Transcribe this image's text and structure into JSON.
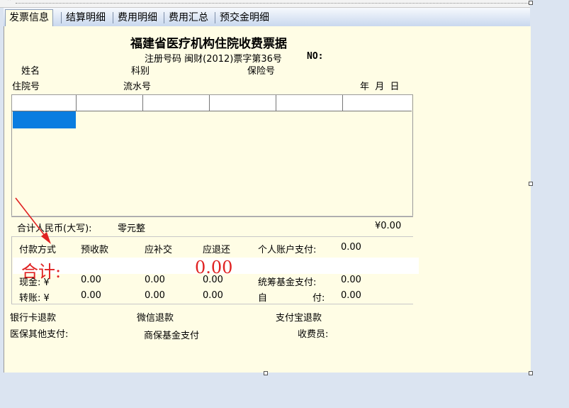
{
  "tabs": [
    {
      "label": "发票信息",
      "active": true
    },
    {
      "label": "结算明细",
      "active": false
    },
    {
      "label": "费用明细",
      "active": false
    },
    {
      "label": "费用汇总",
      "active": false
    },
    {
      "label": "预交金明细",
      "active": false
    }
  ],
  "receipt": {
    "title": "福建省医疗机构住院收费票据",
    "reg_no": "注册号码 闽财(2012)票字第36号",
    "no_label": "NO:",
    "name_label": "姓名",
    "dept_label": "科别",
    "insurance_label": "保险号",
    "admission_label": "住院号",
    "serial_label": "流水号",
    "date_label": "年  月  日"
  },
  "grid": {
    "columns": [
      "",
      "",
      "",
      "",
      "",
      ""
    ],
    "selected_row": 0
  },
  "totals": {
    "rmb_label": "合计人民币(大写):",
    "rmb_words": "零元整",
    "rmb_amount": "¥0.00"
  },
  "payment": {
    "headers": {
      "method": "付款方式",
      "prepaid": "预收款",
      "supplement": "应补交",
      "refund": "应退还",
      "personal_account": "个人账户支付:",
      "personal_account_value": "0.00"
    },
    "annotation": {
      "total_label": "合计:",
      "total_value": "0.00"
    },
    "cash": {
      "label": "现金: ¥",
      "prepaid": "0.00",
      "supplement": "0.00",
      "refund": "0.00",
      "fund_label": "统筹基金支付:",
      "fund_value": "0.00"
    },
    "transfer": {
      "label": "转账: ¥",
      "prepaid": "0.00",
      "supplement": "0.00",
      "refund": "0.00",
      "self_label": "自",
      "self_label2": "付:",
      "self_value": "0.00"
    }
  },
  "footer": {
    "bank_refund": "银行卡退款",
    "wechat_refund": "微信退款",
    "alipay_refund": "支付宝退款",
    "other_insurance": "医保其他支付:",
    "commercial_fund": "商保基金支付",
    "cashier": "收费员:"
  },
  "colors": {
    "panel_bg": "#fffde5",
    "selection": "#0a7de0",
    "annotation_red": "#e02222"
  }
}
